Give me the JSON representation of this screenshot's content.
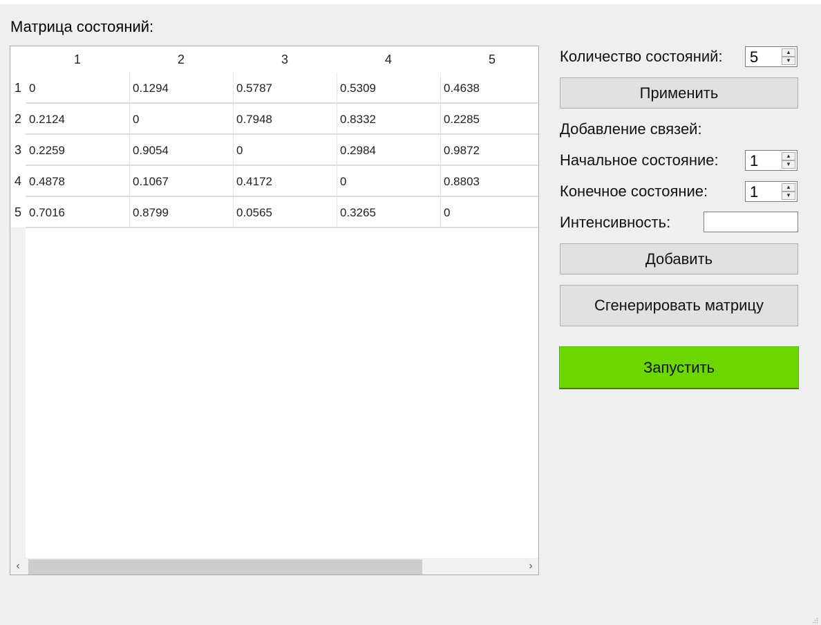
{
  "matrix": {
    "label": "Матрица состояний:",
    "columns": [
      "1",
      "2",
      "3",
      "4",
      "5"
    ],
    "rows": [
      {
        "header": "1",
        "cells": [
          "0",
          "0.1294",
          "0.5787",
          "0.5309",
          "0.4638"
        ]
      },
      {
        "header": "2",
        "cells": [
          "0.2124",
          "0",
          "0.7948",
          "0.8332",
          "0.2285"
        ]
      },
      {
        "header": "3",
        "cells": [
          "0.2259",
          "0.9054",
          "0",
          "0.2984",
          "0.9872"
        ]
      },
      {
        "header": "4",
        "cells": [
          "0.4878",
          "0.1067",
          "0.4172",
          "0",
          "0.8803"
        ]
      },
      {
        "header": "5",
        "cells": [
          "0.7016",
          "0.8799",
          "0.0565",
          "0.3265",
          "0"
        ]
      }
    ],
    "scroll_left_icon": "‹",
    "scroll_right_icon": "›"
  },
  "controls": {
    "states_count_label": "Количество состояний:",
    "states_count_value": "5",
    "apply_button": "Применить",
    "add_links_label": "Добавление связей:",
    "start_state_label": "Начальное состояние:",
    "start_state_value": "1",
    "end_state_label": "Конечное состояние:",
    "end_state_value": "1",
    "intensity_label": "Интенсивность:",
    "intensity_value": "",
    "add_button": "Добавить",
    "generate_button": "Сгенерировать матрицу",
    "run_button": "Запустить"
  },
  "colors": {
    "run_button": "#6cd700",
    "window_bg": "#efefef"
  }
}
